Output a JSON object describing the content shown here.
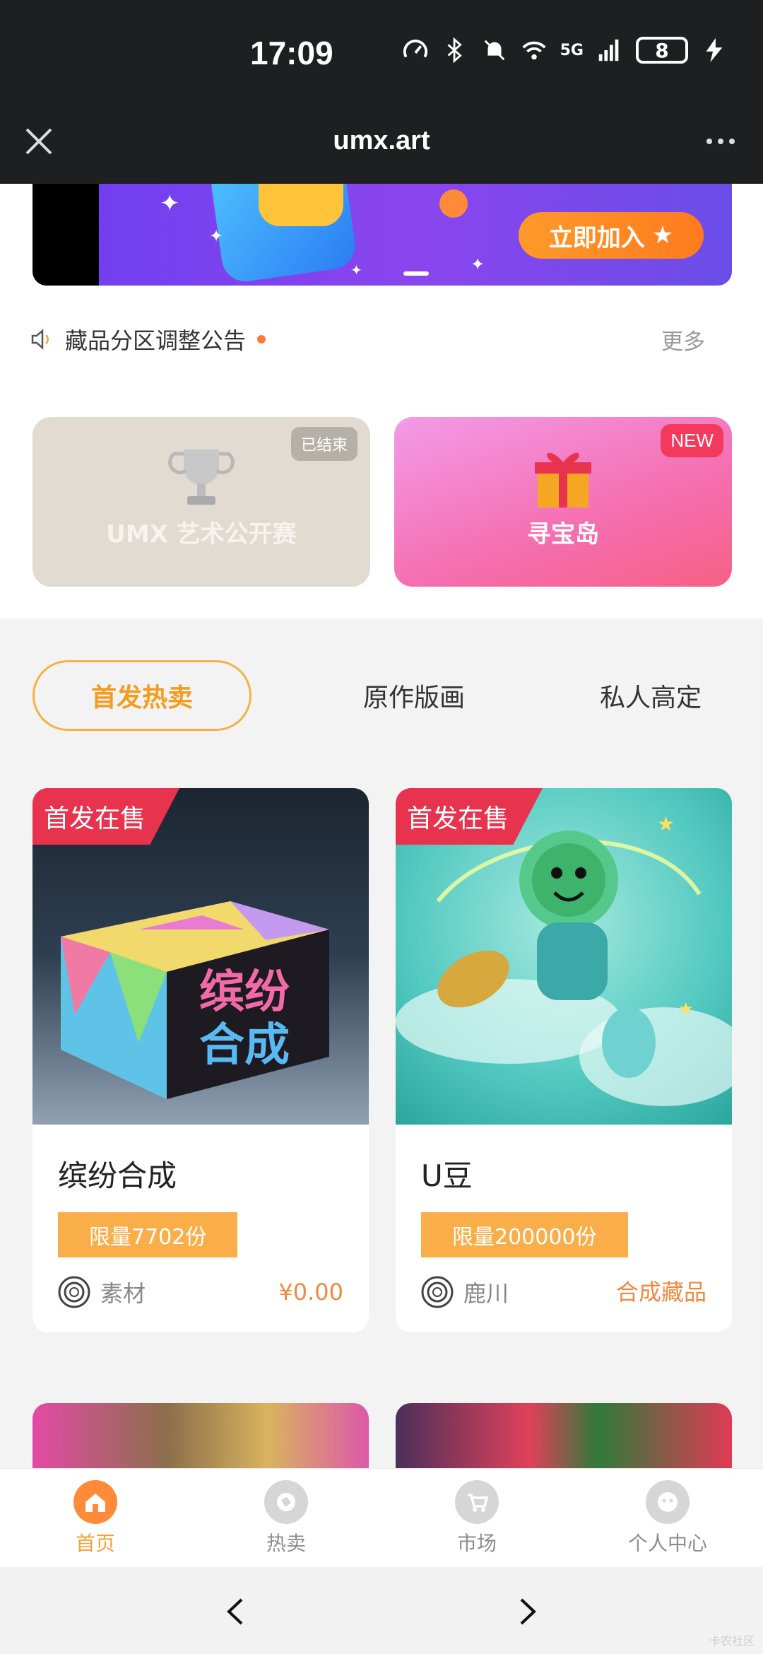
{
  "status_bar": {
    "time": "17:09",
    "battery": "8",
    "network": "5G"
  },
  "browser": {
    "title": "umx.art"
  },
  "banner": {
    "join_label": "立即加入"
  },
  "notice": {
    "text": "藏品分区调整公告",
    "more_label": "更多"
  },
  "features": [
    {
      "title": "UMX 艺术公开赛",
      "badge": "已结束"
    },
    {
      "title": "寻宝岛",
      "badge": "NEW"
    }
  ],
  "tabs": [
    {
      "label": "首发热卖",
      "active": true
    },
    {
      "label": "原作版画",
      "active": false
    },
    {
      "label": "私人高定",
      "active": false
    }
  ],
  "products": [
    {
      "tag": "首发在售",
      "box_text_line1": "缤纷",
      "box_text_line2": "合成",
      "name": "缤纷合成",
      "limit": "限量7702份",
      "author": "素材",
      "price": "¥0.00"
    },
    {
      "tag": "首发在售",
      "name": "U豆",
      "limit": "限量200000份",
      "author": "鹿川",
      "price": "合成藏品"
    }
  ],
  "bottom_nav": [
    {
      "label": "首页",
      "active": true,
      "icon": "home-icon"
    },
    {
      "label": "热卖",
      "active": false,
      "icon": "fire-icon"
    },
    {
      "label": "市场",
      "active": false,
      "icon": "cart-icon"
    },
    {
      "label": "个人中心",
      "active": false,
      "icon": "profile-icon"
    }
  ],
  "colors": {
    "accent": "#f7a035",
    "presale": "#e8334e",
    "limit": "#f9ae4a",
    "price": "#f08a42"
  },
  "watermark": "卡农社区"
}
